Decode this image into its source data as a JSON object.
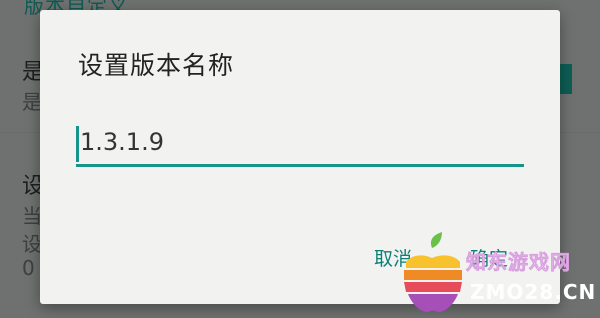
{
  "background": {
    "section_title": "版本自定义",
    "row1_title": "是",
    "row1_sub": "是",
    "row2_title": "设",
    "row2_sub1": "当",
    "row2_sub2": "设",
    "row2_sub3": "0"
  },
  "dialog": {
    "title": "设置版本名称",
    "input_value": "1.3.1.9",
    "cancel_label": "取消",
    "ok_label": "确定"
  },
  "watermark": {
    "site_name": "知东游戏网",
    "domain": "ZMO28.CN"
  },
  "colors": {
    "accent": "#14948a",
    "button_text": "#0e7f76",
    "scrim": "#6f7170",
    "dialog_bg": "#f2f2f1"
  }
}
